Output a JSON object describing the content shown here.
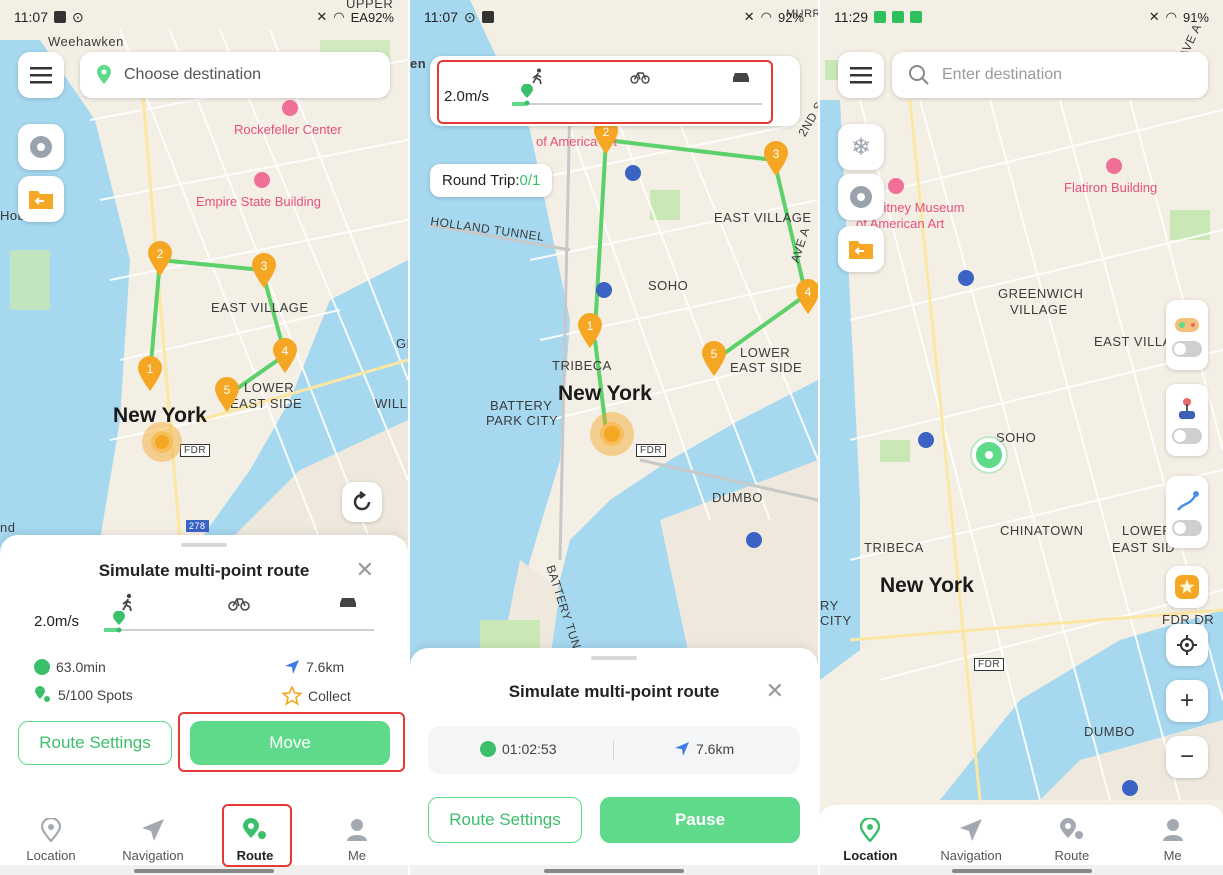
{
  "screen1": {
    "status_time": "11:07",
    "status_right": "EA92%",
    "search_placeholder": "Choose destination",
    "map_labels": {
      "weehawken": "Weehawken",
      "upper": "UPPER",
      "rockefeller": "Rockefeller Center",
      "empire": "Empire State Building",
      "hoboken": "Hoboken",
      "east_village": "EAST VILLAGE",
      "lower_east_side_1": "LOWER",
      "lower_east_side_2": "EAST SIDE",
      "new_york": "New York",
      "will": "WILL",
      "gr": "GR",
      "fdr": "FDR",
      "nd": "nd",
      "route_278": "278"
    },
    "markers": [
      "1",
      "2",
      "3",
      "4",
      "5"
    ],
    "sheet": {
      "title": "Simulate multi-point route",
      "speed": "2.0m/s",
      "duration": "63.0min",
      "distance": "7.6km",
      "spots": "5/100 Spots",
      "collect": "Collect",
      "route_settings": "Route Settings",
      "move": "Move"
    },
    "nav": [
      "Location",
      "Navigation",
      "Route",
      "Me"
    ],
    "active_tab": "Route"
  },
  "screen2": {
    "status_time": "11:07",
    "status_right": "92%",
    "speed": "2.0m/s",
    "round_trip_label": "Round Trip:",
    "round_trip_value": "0/1",
    "map_labels": {
      "en": "en",
      "of_america": "of America Art",
      "east_village": "EAST VILLAGE",
      "holland": "HOLLAND TUNNEL",
      "soho": "SOHO",
      "tribeca": "TRIBECA",
      "lower_1": "LOWER",
      "lower_2": "EAST SIDE",
      "new_york": "New York",
      "battery_1": "BATTERY",
      "battery_2": "PARK CITY",
      "fdr": "FDR",
      "dumbo": "DUMBO",
      "battery_tunnel": "BATTERY TUN",
      "ave_a": "AVE A",
      "nd_st": "2ND S",
      "murr": "MURR"
    },
    "markers": [
      "1",
      "2",
      "3",
      "4",
      "5"
    ],
    "sheet": {
      "title": "Simulate multi-point route",
      "elapsed": "01:02:53",
      "distance": "7.6km",
      "route_settings": "Route Settings",
      "pause": "Pause"
    }
  },
  "screen3": {
    "status_time": "11:29",
    "status_right": "91%",
    "search_placeholder": "Enter destination",
    "map_labels": {
      "flatiron": "Flatiron Building",
      "museum_1": "Whitney Museum",
      "museum_2": "of American Art",
      "greenwich_1": "GREENWICH",
      "greenwich_2": "VILLAGE",
      "east_vill": "EAST VILLA",
      "soho": "SOHO",
      "chinatown": "CHINATOWN",
      "lower_1": "LOWER",
      "lower_2": "EAST SID",
      "tribeca": "TRIBECA",
      "new_york": "New York",
      "ry": "RY",
      "city": "CITY",
      "fdr_dr": "FDR DR",
      "fdr": "FDR",
      "dumbo": "DUMBO",
      "ave_a": "AVE A"
    },
    "zoom_in": "+",
    "zoom_out": "−",
    "nav": [
      "Location",
      "Navigation",
      "Route",
      "Me"
    ],
    "active_tab": "Location"
  },
  "colors": {
    "accent_green": "#5fd98a",
    "marker_orange": "#f5a623",
    "highlight_red": "#e53935",
    "water": "#a6d8f0",
    "land": "#f4efe5",
    "park": "#c9e8b5",
    "route_line": "#5cd06a"
  }
}
